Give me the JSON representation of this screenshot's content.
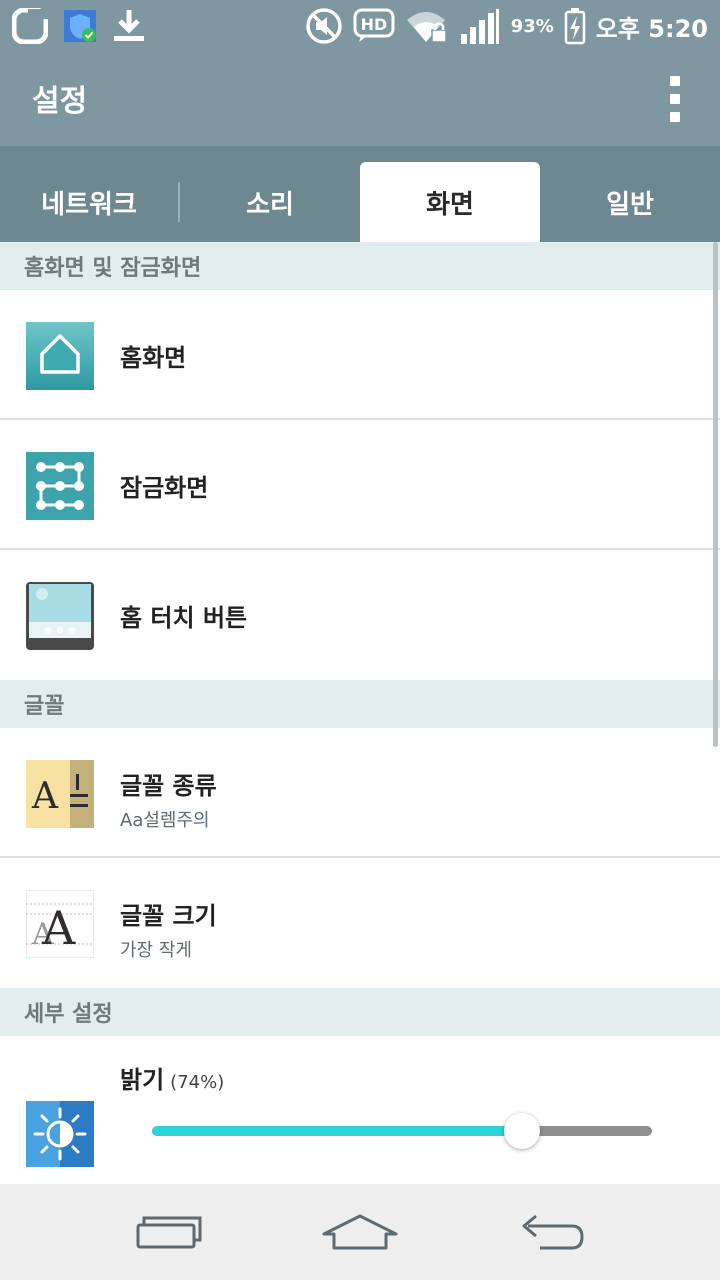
{
  "status_bar": {
    "icons": [
      "g-logo-icon",
      "shield-check-icon",
      "download-icon",
      "mute-icon",
      "hd-voice-icon",
      "wifi-lock-icon",
      "signal-icon",
      "battery-charging-icon"
    ],
    "battery_percent": "93%",
    "time": "오후 5:20"
  },
  "action_bar": {
    "title": "설정",
    "menu_icon": "overflow-menu-icon"
  },
  "tabs": [
    {
      "label": "네트워크",
      "active": false
    },
    {
      "label": "소리",
      "active": false
    },
    {
      "label": "화면",
      "active": true
    },
    {
      "label": "일반",
      "active": false
    }
  ],
  "sections": {
    "home_lock": "홈화면 및 잠금화면",
    "font": "글꼴",
    "detail": "세부 설정"
  },
  "items": {
    "home_screen": {
      "label": "홈화면",
      "icon": "home-screen-icon"
    },
    "lock_screen": {
      "label": "잠금화면",
      "icon": "lock-screen-icon"
    },
    "home_touch": {
      "label": "홈 터치 버튼",
      "icon": "home-touch-buttons-icon"
    },
    "font_type": {
      "label": "글꼴 종류",
      "sub": "Aa설렘주의",
      "icon": "font-type-icon"
    },
    "font_size": {
      "label": "글꼴 크기",
      "sub": "가장 작게",
      "icon": "font-size-icon"
    },
    "brightness": {
      "label": "밝기",
      "value_text": "(74%)",
      "level": 0.74,
      "icon": "brightness-icon"
    }
  },
  "nav_bar": {
    "icons": [
      "recent-apps-icon",
      "home-icon",
      "back-icon"
    ]
  },
  "colors": {
    "header": "#7e97a1",
    "tabs_bg": "#6e8892",
    "section_bg": "#e3ecee",
    "slider_accent": "#2fd3d6"
  }
}
